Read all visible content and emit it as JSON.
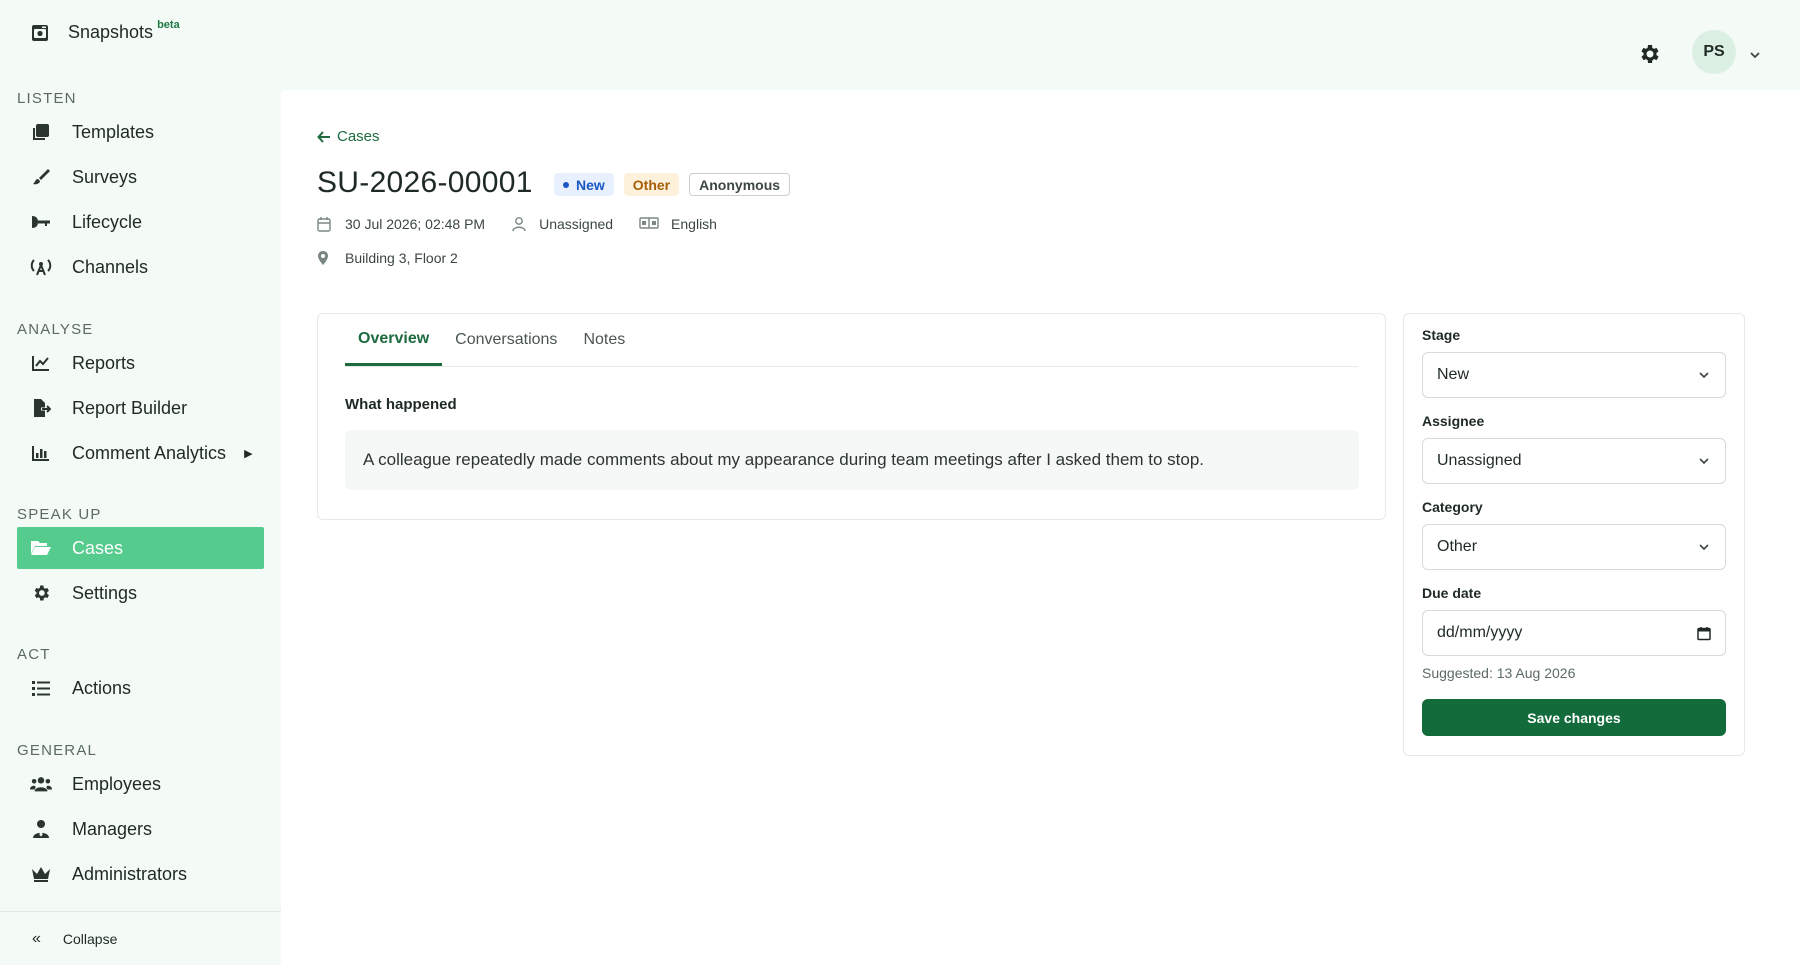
{
  "sidebar": {
    "brand": {
      "label": "Snapshots",
      "badge": "beta"
    },
    "sections": {
      "listen": "LISTEN",
      "analyse": "ANALYSE",
      "speak_up": "SPEAK UP",
      "act": "ACT",
      "general": "GENERAL"
    },
    "items": {
      "templates": "Templates",
      "surveys": "Surveys",
      "lifecycle": "Lifecycle",
      "channels": "Channels",
      "reports": "Reports",
      "report_builder": "Report Builder",
      "comment_analytics": "Comment Analytics",
      "cases": "Cases",
      "settings": "Settings",
      "actions": "Actions",
      "employees": "Employees",
      "managers": "Managers",
      "administrators": "Administrators"
    },
    "collapse_label": "Collapse",
    "active_item": "cases",
    "accent_color": "#55cc8e"
  },
  "header": {
    "avatar_initials": "PS"
  },
  "case": {
    "back_label": "Cases",
    "id": "SU-2026-00001",
    "badges": {
      "stage": "New",
      "category": "Other",
      "reporter": "Anonymous"
    },
    "date": "30 Jul 2026; 02:48 PM",
    "assignee": "Unassigned",
    "language": "English",
    "location": "Building 3, Floor 2"
  },
  "tabs": {
    "overview": "Overview",
    "conversations": "Conversations",
    "notes": "Notes",
    "active": "overview"
  },
  "overview": {
    "what_happened_label": "What happened",
    "what_happened_text": "A colleague repeatedly made comments about my appearance during team meetings after I asked them to stop."
  },
  "panel": {
    "stage_label": "Stage",
    "stage_value": "New",
    "assignee_label": "Assignee",
    "assignee_value": "Unassigned",
    "category_label": "Category",
    "category_value": "Other",
    "due_date_label": "Due date",
    "due_date_placeholder": "dd/mm/yyyy",
    "suggested": "Suggested: 13 Aug 2026",
    "save_label": "Save changes",
    "primary_color": "#136b3b"
  }
}
